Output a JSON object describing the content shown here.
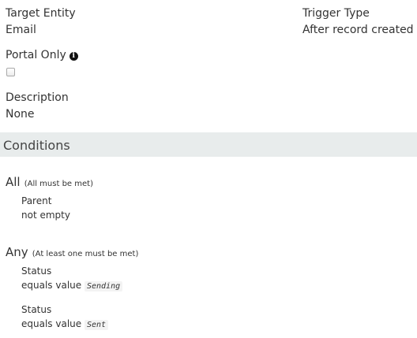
{
  "details": {
    "target_entity_label": "Target Entity",
    "target_entity_value": "Email",
    "trigger_type_label": "Trigger Type",
    "trigger_type_value": "After record created",
    "portal_only_label": "Portal Only",
    "portal_only_checked": false,
    "info_icon": "info-icon",
    "description_label": "Description",
    "description_value": "None"
  },
  "conditions": {
    "title": "Conditions",
    "all": {
      "label": "All",
      "hint": "(All must be met)",
      "items": [
        {
          "field": "Parent",
          "condition": "not empty",
          "value": ""
        }
      ]
    },
    "any": {
      "label": "Any",
      "hint": "(At least one must be met)",
      "items": [
        {
          "field": "Status",
          "condition": "equals value",
          "value": "Sending"
        },
        {
          "field": "Status",
          "condition": "equals value",
          "value": "Sent"
        }
      ]
    }
  },
  "colors": {
    "section_bar": "#e8ecec",
    "text": "#333333"
  }
}
